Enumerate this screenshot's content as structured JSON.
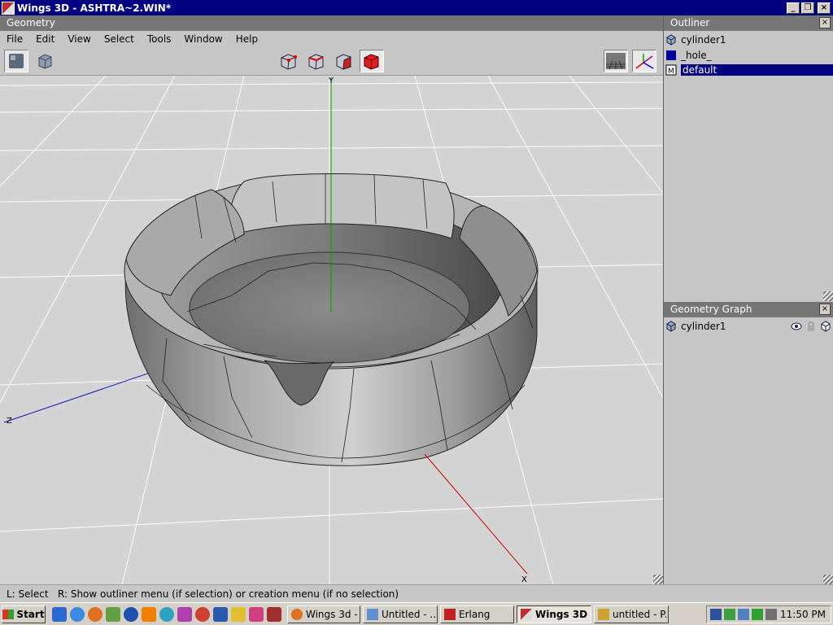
{
  "window": {
    "title": "Wings 3D - ASHTRA~2.WIN*"
  },
  "geometry": {
    "header": "Geometry",
    "menu": [
      "File",
      "Edit",
      "View",
      "Select",
      "Tools",
      "Window",
      "Help"
    ],
    "axes": {
      "y": "Y",
      "z": "Z",
      "x": "X"
    }
  },
  "outliner": {
    "header": "Outliner",
    "items": [
      {
        "label": "cylinder1",
        "icon": "cube-icon"
      },
      {
        "label": "_hole_",
        "icon": "material-swatch-icon"
      },
      {
        "label": "default",
        "icon": "material-m-icon"
      }
    ]
  },
  "geometry_graph": {
    "header": "Geometry Graph",
    "items": [
      {
        "label": "cylinder1",
        "icon": "cube-icon"
      }
    ]
  },
  "status": {
    "text": "L: Select   R: Show outliner menu (if selection) or creation menu (if no selection)"
  },
  "taskbar": {
    "start": "Start",
    "tasks": [
      "Wings 3d - ...",
      "Untitled - ...",
      "Erlang",
      "Wings 3D ...",
      "untitled - P..."
    ],
    "clock": "11:50 PM"
  },
  "colors": {
    "title_bar": "#000080",
    "header": "#767676",
    "selection": "#000080",
    "model": "#9a9a9a"
  }
}
